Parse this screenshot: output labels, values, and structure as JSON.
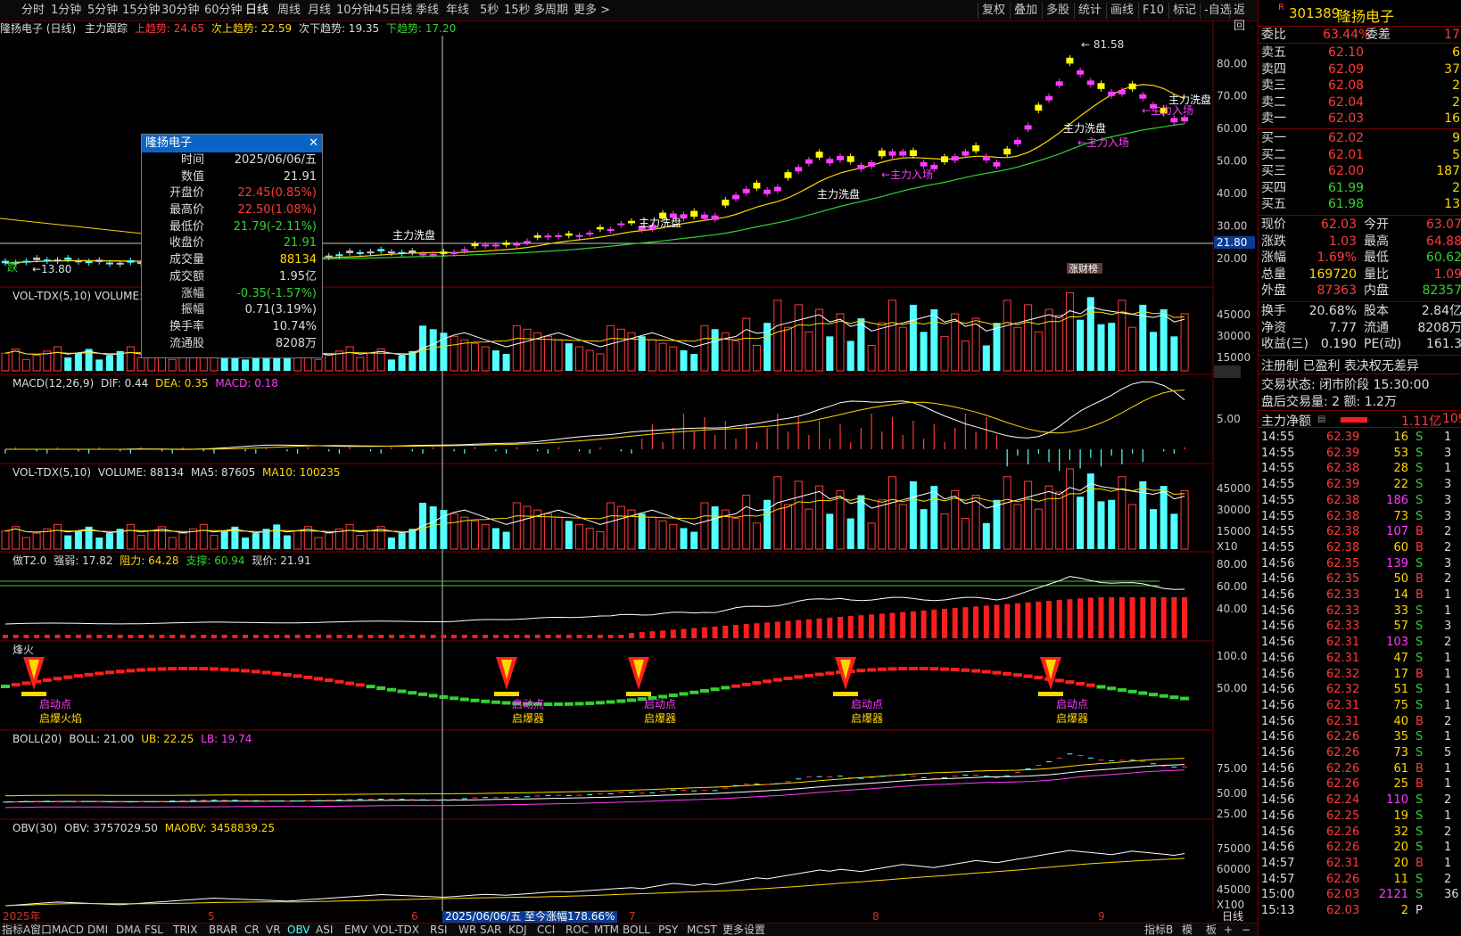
{
  "toolbar": {
    "tabs": [
      "分时",
      "1分钟",
      "5分钟",
      "15分钟",
      "30分钟",
      "60分钟",
      "日线",
      "周线",
      "月线",
      "10分钟",
      "45日线",
      "季线",
      "年线",
      "5秒",
      "15秒",
      "多周期",
      "更多 >"
    ],
    "active_tab": "日线",
    "right_buttons": [
      "复权",
      "叠加",
      "多股",
      "统计",
      "画线",
      "F10",
      "标记",
      "-自选",
      "返回"
    ]
  },
  "main_panel": {
    "stock_title": "隆扬电子 (日线)",
    "indicator": "主力跟踪",
    "up_trend_label": "上趋势: 24.65",
    "next_up_label": "次上趋势: 22.59",
    "next_down_label": "次下趋势: 19.35",
    "down_trend_label": "下趋势: 17.20",
    "high_marker": "81.58",
    "low_marker": "13.80",
    "current_price_tag": "21.80",
    "annotations": [
      "主力洗盘",
      "主力入场",
      "涨财榜",
      "跌"
    ],
    "y_ticks": [
      "80.00",
      "70.00",
      "60.00",
      "50.00",
      "40.00",
      "30.00",
      "20.00"
    ]
  },
  "tooltip": {
    "title": "隆扬电子",
    "rows": [
      {
        "k": "时间",
        "v": "2025/06/06/五",
        "color": "#dcdcdc"
      },
      {
        "k": "数值",
        "v": "21.91",
        "color": "#dcdcdc"
      },
      {
        "k": "开盘价",
        "v": "22.45(0.85%)",
        "color": "#ff3c3c"
      },
      {
        "k": "最高价",
        "v": "22.50(1.08%)",
        "color": "#ff3c3c"
      },
      {
        "k": "最低价",
        "v": "21.79(-2.11%)",
        "color": "#32d232"
      },
      {
        "k": "收盘价",
        "v": "21.91",
        "color": "#32d232"
      },
      {
        "k": "成交量",
        "v": "88134",
        "color": "#ffd700"
      },
      {
        "k": "成交额",
        "v": "1.95亿",
        "color": "#dcdcdc"
      },
      {
        "k": "涨幅",
        "v": "-0.35(-1.57%)",
        "color": "#32d232"
      },
      {
        "k": "振幅",
        "v": "0.71(3.19%)",
        "color": "#dcdcdc"
      },
      {
        "k": "换手率",
        "v": "10.74%",
        "color": "#dcdcdc"
      },
      {
        "k": "流通股",
        "v": "8208万",
        "color": "#dcdcdc"
      }
    ]
  },
  "panels": {
    "vol1": {
      "header": "VOL-TDX(5,10) VOLUME:",
      "ticks": [
        "45000",
        "30000",
        "15000",
        "X10"
      ]
    },
    "macd": {
      "name": "MACD(12,26,9)",
      "dif": "DIF: 0.44",
      "dea": "DEA: 0.35",
      "macd": "MACD: 0.18",
      "ticks": [
        "5.00"
      ]
    },
    "vol2": {
      "name": "VOL-TDX(5,10)",
      "volume": "VOLUME: 88134",
      "ma5": "MA5: 87605",
      "ma10": "MA10: 100235",
      "ticks": [
        "45000",
        "30000",
        "15000",
        "X10"
      ]
    },
    "t2": {
      "name": "做T2.0",
      "strong": "强弱: 17.82",
      "resist": "阻力: 64.28",
      "support": "支撑: 60.94",
      "price": "现价: 21.91",
      "ticks": [
        "80.00",
        "60.00",
        "40.00"
      ]
    },
    "fire": {
      "name": "烽火",
      "ticks": [
        "100.0",
        "50.00"
      ],
      "labels": [
        "启动点",
        "启爆器",
        "启爆火焰"
      ]
    },
    "boll": {
      "name": "BOLL(20)",
      "boll": "BOLL: 21.00",
      "ub": "UB: 22.25",
      "lb": "LB: 19.74",
      "ticks": [
        "75.00",
        "50.00",
        "25.00"
      ]
    },
    "obv": {
      "name": "OBV(30)",
      "obv": "OBV: 3757029.50",
      "maobv": "MAOBV: 3458839.25",
      "ticks": [
        "75000",
        "60000",
        "45000",
        "X100"
      ]
    }
  },
  "date_bar": {
    "labels": [
      "2025年",
      "5",
      "6",
      "7",
      "8",
      "9"
    ],
    "highlight": "2025/06/06/五  至今涨幅178.66%",
    "period": "日线"
  },
  "bottom_tabs": [
    "指标A",
    "窗口",
    "MACD",
    "DMI",
    "DMA",
    "FSL",
    "TRIX",
    "BRAR",
    "CR",
    "VR",
    "OBV",
    "ASI",
    "EMV",
    "VOL-TDX",
    "RSI",
    "WR",
    "SAR",
    "KDJ",
    "CCI",
    "ROC",
    "MTM",
    "BOLL",
    "PSY",
    "MCST",
    "更多",
    "设置"
  ],
  "bottom_right": [
    "指标B",
    "模",
    "板",
    "+",
    "−"
  ],
  "quote": {
    "code": "301389",
    "name": "隆扬电子",
    "webi_label": "委比",
    "webi": "63.44%",
    "wecha_label": "委差",
    "wecha": "17",
    "asks": [
      {
        "label": "卖五",
        "price": "62.10",
        "vol": "6"
      },
      {
        "label": "卖四",
        "price": "62.09",
        "vol": "37"
      },
      {
        "label": "卖三",
        "price": "62.08",
        "vol": "2"
      },
      {
        "label": "卖二",
        "price": "62.04",
        "vol": "2"
      },
      {
        "label": "卖一",
        "price": "62.03",
        "vol": "16"
      }
    ],
    "bids": [
      {
        "label": "买一",
        "price": "62.02",
        "vol": "9"
      },
      {
        "label": "买二",
        "price": "62.01",
        "vol": "5"
      },
      {
        "label": "买三",
        "price": "62.00",
        "vol": "187"
      },
      {
        "label": "买四",
        "price": "61.99",
        "vol": "2"
      },
      {
        "label": "买五",
        "price": "61.98",
        "vol": "13"
      }
    ],
    "stats": [
      {
        "l1": "现价",
        "v1": "62.03",
        "c1": "#ff3c3c",
        "l2": "今开",
        "v2": "63.07",
        "c2": "#ff3c3c"
      },
      {
        "l1": "涨跌",
        "v1": "1.03",
        "c1": "#ff3c3c",
        "l2": "最高",
        "v2": "64.88",
        "c2": "#ff3c3c"
      },
      {
        "l1": "涨幅",
        "v1": "1.69%",
        "c1": "#ff3c3c",
        "l2": "最低",
        "v2": "60.62",
        "c2": "#32d232"
      },
      {
        "l1": "总量",
        "v1": "169720",
        "c1": "#ffd700",
        "l2": "量比",
        "v2": "1.09",
        "c2": "#ff3c3c"
      },
      {
        "l1": "外盘",
        "v1": "87363",
        "c1": "#ff3c3c",
        "l2": "内盘",
        "v2": "82357",
        "c2": "#32d232"
      }
    ],
    "stats2": [
      {
        "l1": "换手",
        "v1": "20.68%",
        "l2": "股本",
        "v2": "2.84亿"
      },
      {
        "l1": "净资",
        "v1": "7.77",
        "l2": "流通",
        "v2": "8208万"
      },
      {
        "l1": "收益(三)",
        "v1": "0.190",
        "l2": "PE(动)",
        "v2": "161.3"
      }
    ],
    "tags": "注册制 已盈利 表决权无差异",
    "trade_status": "交易状态: 闭市阶段 15:30:00",
    "after_hours": "盘后交易量: 2  额: 1.2万",
    "net_flow_label": "主力净额",
    "net_flow": "1.11亿",
    "net_flow_pct": "109",
    "ticks": [
      [
        "14:55",
        "62.39",
        "16",
        "S",
        "1"
      ],
      [
        "14:55",
        "62.39",
        "53",
        "S",
        "3"
      ],
      [
        "14:55",
        "62.38",
        "28",
        "S",
        "1"
      ],
      [
        "14:55",
        "62.39",
        "22",
        "S",
        "3"
      ],
      [
        "14:55",
        "62.38",
        "186",
        "S",
        "3"
      ],
      [
        "14:55",
        "62.38",
        "73",
        "S",
        "3"
      ],
      [
        "14:55",
        "62.38",
        "107",
        "B",
        "2"
      ],
      [
        "14:55",
        "62.38",
        "60",
        "B",
        "2"
      ],
      [
        "14:56",
        "62.35",
        "139",
        "S",
        "3"
      ],
      [
        "14:56",
        "62.35",
        "50",
        "B",
        "2"
      ],
      [
        "14:56",
        "62.33",
        "14",
        "B",
        "1"
      ],
      [
        "14:56",
        "62.33",
        "33",
        "S",
        "1"
      ],
      [
        "14:56",
        "62.33",
        "57",
        "S",
        "3"
      ],
      [
        "14:56",
        "62.31",
        "103",
        "S",
        "2"
      ],
      [
        "14:56",
        "62.31",
        "47",
        "S",
        "1"
      ],
      [
        "14:56",
        "62.32",
        "17",
        "B",
        "1"
      ],
      [
        "14:56",
        "62.32",
        "51",
        "S",
        "1"
      ],
      [
        "14:56",
        "62.31",
        "75",
        "S",
        "1"
      ],
      [
        "14:56",
        "62.31",
        "40",
        "B",
        "2"
      ],
      [
        "14:56",
        "62.26",
        "35",
        "S",
        "1"
      ],
      [
        "14:56",
        "62.26",
        "73",
        "S",
        "5"
      ],
      [
        "14:56",
        "62.26",
        "61",
        "B",
        "1"
      ],
      [
        "14:56",
        "62.26",
        "25",
        "B",
        "1"
      ],
      [
        "14:56",
        "62.24",
        "110",
        "S",
        "2"
      ],
      [
        "14:56",
        "62.25",
        "19",
        "S",
        "1"
      ],
      [
        "14:56",
        "62.26",
        "32",
        "S",
        "2"
      ],
      [
        "14:56",
        "62.26",
        "20",
        "S",
        "1"
      ],
      [
        "14:57",
        "62.31",
        "20",
        "B",
        "1"
      ],
      [
        "14:57",
        "62.26",
        "11",
        "S",
        "2"
      ],
      [
        "15:00",
        "62.03",
        "2121",
        "S",
        "36"
      ],
      [
        "15:13",
        "62.03",
        "2",
        "P",
        ""
      ]
    ]
  },
  "colors": {
    "up": "#ff3c3c",
    "down": "#32d232",
    "cyan": "#54ffff",
    "yellow": "#ffd700",
    "magenta": "#ff3cff",
    "grid": "#7a0000"
  }
}
